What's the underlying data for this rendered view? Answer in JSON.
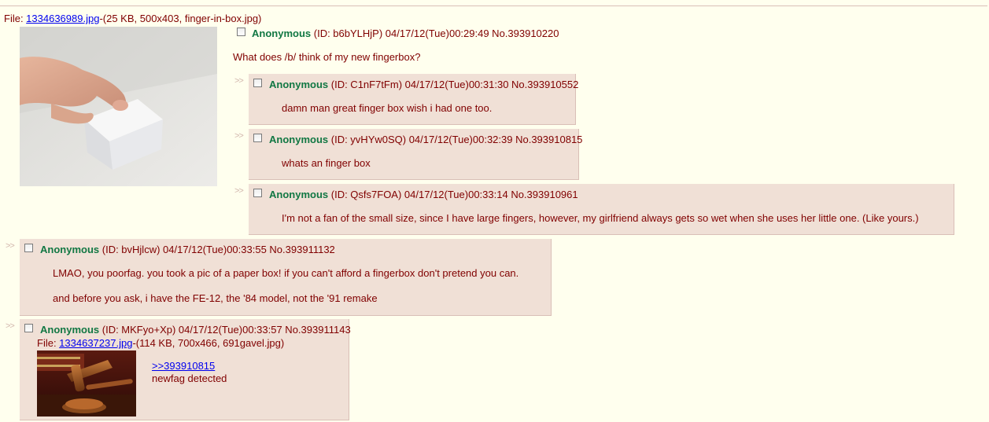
{
  "op": {
    "file_label": "File: ",
    "file_link": "1334636989.jpg",
    "file_meta": "-(25 KB, 500x403, finger-in-box.jpg)",
    "name": "Anonymous",
    "info": "(ID: b6bYLHjP) 04/17/12(Tue)00:29:49 No.393910220",
    "message": "What does /b/ think of my new fingerbox?"
  },
  "replies": [
    {
      "arrows": ">>",
      "name": "Anonymous",
      "info": "(ID: C1nF7tFm) 04/17/12(Tue)00:31:30 No.393910552",
      "lines": [
        "damn man great finger box wish i had one too."
      ]
    },
    {
      "arrows": ">>",
      "name": "Anonymous",
      "info": "(ID: yvHYw0SQ) 04/17/12(Tue)00:32:39 No.393910815",
      "lines": [
        "whats an finger box"
      ]
    },
    {
      "arrows": ">>",
      "name": "Anonymous",
      "info": "(ID: Qsfs7FOA) 04/17/12(Tue)00:33:14 No.393910961",
      "lines": [
        "I'm not a fan of the small size, since I have large fingers, however, my girlfriend always gets so wet when she uses her little one. (Like yours.)"
      ]
    },
    {
      "arrows": ">>",
      "name": "Anonymous",
      "info": "(ID: bvHjlcw) 04/17/12(Tue)00:33:55 No.393911132",
      "lines": [
        "LMAO, you poorfag. you took a pic of a paper box! if you can't afford a fingerbox don't pretend you can.",
        "and before you ask, i have the FE-12, the '84 model, not the '91 remake"
      ]
    },
    {
      "arrows": ">>",
      "name": "Anonymous",
      "info": "(ID: MKFyo+Xp) 04/17/12(Tue)00:33:57 No.393911143",
      "file_label": "File: ",
      "file_link": "1334637237.jpg",
      "file_meta": "-(114 KB, 700x466, 691gavel.jpg)",
      "quote_link": ">>393910815",
      "lines": [
        "newfag detected"
      ]
    }
  ]
}
